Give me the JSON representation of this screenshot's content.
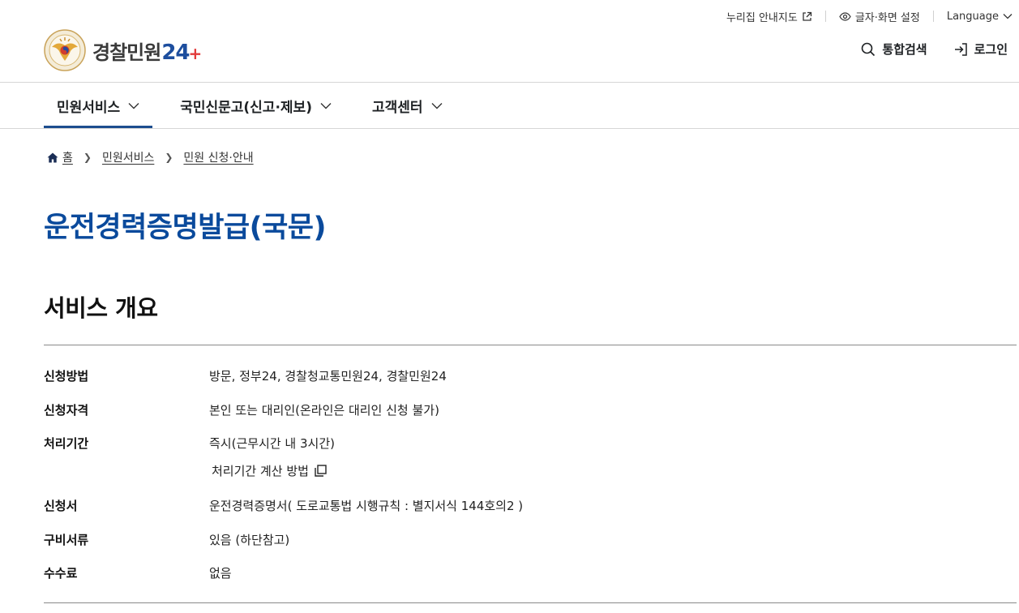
{
  "utility": {
    "sitemap_label": "누리집 안내지도",
    "display_label": "글자·화면 설정",
    "language_label": "Language"
  },
  "header": {
    "logo_text": "경찰민원",
    "logo_number": "24",
    "search_label": "통합검색",
    "login_label": "로그인"
  },
  "nav": {
    "items": [
      {
        "label": "민원서비스"
      },
      {
        "label": "국민신문고(신고·제보)"
      },
      {
        "label": "고객센터"
      }
    ]
  },
  "breadcrumb": {
    "home": "홈",
    "level1": "민원서비스",
    "level2": "민원 신청·안내"
  },
  "page": {
    "title": "운전경력증명발급(국문)",
    "section_title": "서비스 개요"
  },
  "overview": {
    "rows": [
      {
        "label": "신청방법",
        "value": "방문, 정부24, 경찰청교통민원24, 경찰민원24"
      },
      {
        "label": "신청자격",
        "value": "본인 또는 대리인(온라인은 대리인 신청 불가)"
      },
      {
        "label": "처리기간",
        "value": "즉시(근무시간 내 3시간)"
      },
      {
        "label": "신청서",
        "value": "운전경력증명서( 도로교통법 시행규칙 : 별지서식 144호의2 )"
      },
      {
        "label": "구비서류",
        "value": "있음 (하단참고)"
      },
      {
        "label": "수수료",
        "value": "없음"
      }
    ],
    "calc_link": "처리기간 계산 방법"
  },
  "colors": {
    "title_blue": "#0a4a9c",
    "nav_active": "#1d4e8f",
    "logo_red": "#e23b3b"
  }
}
